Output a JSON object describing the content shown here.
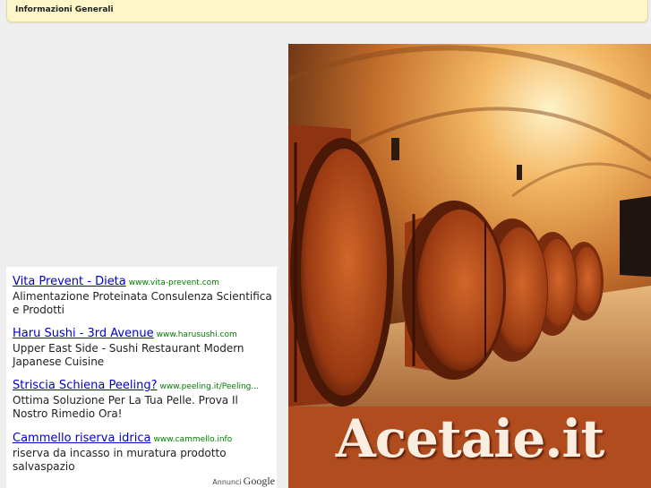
{
  "header": {
    "title": "Informazioni Generali"
  },
  "ads": {
    "items": [
      {
        "title": "Vita Prevent - Dieta",
        "url": "www.vita-prevent.com",
        "desc": "Alimentazione Proteinata Consulenza Scientifica e Prodotti"
      },
      {
        "title": "Haru Sushi - 3rd Avenue",
        "url": "www.harusushi.com",
        "desc": "Upper East Side - Sushi Restaurant Modern Japanese Cuisine"
      },
      {
        "title": "Striscia Schiena Peeling?",
        "url": "www.peeling.it/Peeling...",
        "desc": "Ottima Soluzione Per La Tua Pelle. Prova Il Nostro Rimedio Ora!"
      },
      {
        "title": "Cammello riserva idrica",
        "url": "www.cammello.info",
        "desc": "riserva da incasso in muratura prodotto salvaspazio"
      }
    ],
    "footer_label": "Annunci",
    "footer_brand": "Google"
  },
  "banner": {
    "brand_text": "Acetaie.it",
    "colors": {
      "cellar": "#c8702a",
      "barrel": "#8e3412",
      "bottom": "#b04c1e"
    },
    "image_icon": "wine-cellar-barrels-image"
  }
}
